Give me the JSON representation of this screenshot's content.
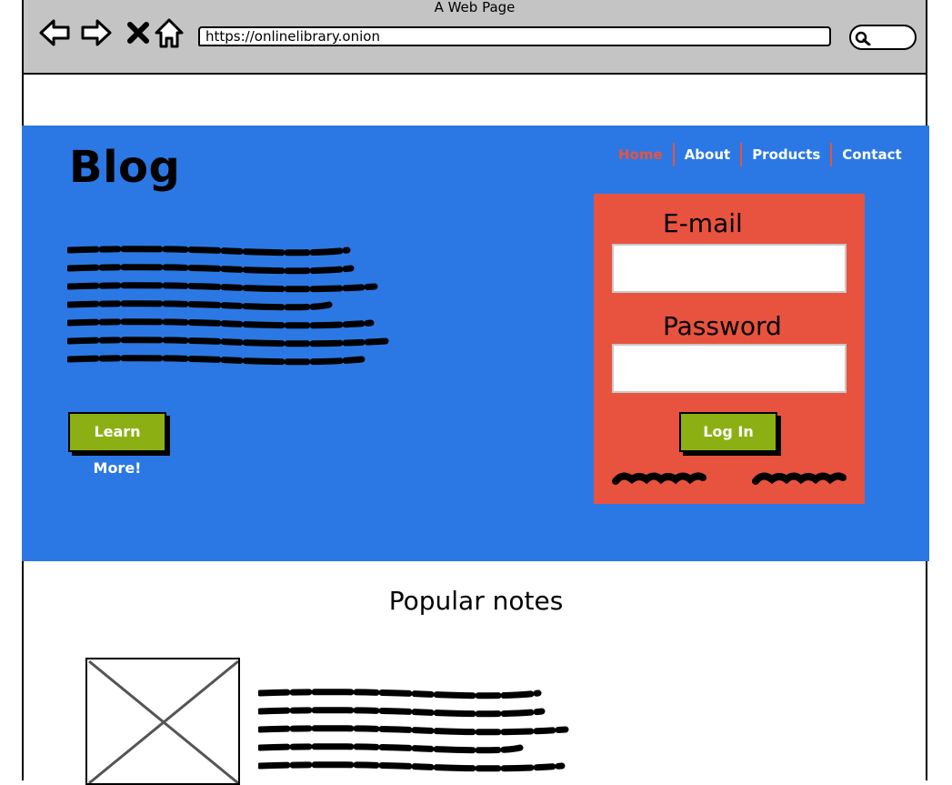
{
  "browser": {
    "window_title": "A Web Page",
    "url": "https://onlinelibrary.onion",
    "buttons": [
      "back-arrow",
      "forward-arrow",
      "close-x",
      "home"
    ]
  },
  "hero": {
    "title": "Blog",
    "learn_more_label": "Learn More!",
    "background": "#2b78e4"
  },
  "nav": {
    "items": [
      {
        "label": "Home",
        "active": true
      },
      {
        "label": "About",
        "active": false
      },
      {
        "label": "Products",
        "active": false
      },
      {
        "label": "Contact",
        "active": false
      }
    ],
    "accent": "#e8533f"
  },
  "login": {
    "email_label": "E-mail",
    "password_label": "Password",
    "login_label": "Log In",
    "background": "#e8533f",
    "button_color": "#8cb014"
  },
  "notes": {
    "title": "Popular notes"
  }
}
